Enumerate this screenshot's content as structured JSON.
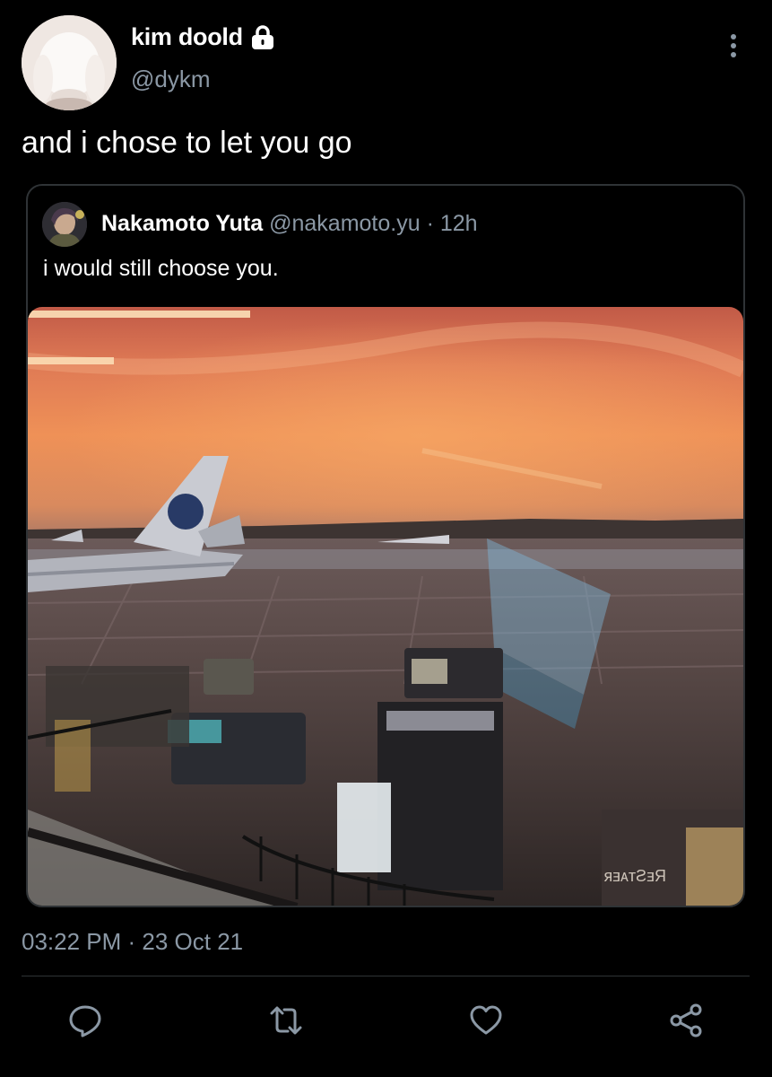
{
  "author": {
    "name": "kim doold",
    "handle": "@dykm",
    "protected_icon": "lock-icon"
  },
  "tweet": {
    "text": "and i chose to let you go",
    "timestamp": "03:22 PM · 23 Oct 21"
  },
  "quoted": {
    "name": "Nakamoto Yuta",
    "handle": "@nakamoto.yu",
    "separator": "·",
    "time": "12h",
    "text": "i would still choose you.",
    "image_text": "RᴇSᴛᴀᴇʀ"
  },
  "actions": {
    "icons": [
      "reply-icon",
      "retweet-icon",
      "like-icon",
      "share-icon"
    ]
  },
  "colors": {
    "background": "#000000",
    "primary_text": "#ffffff",
    "secondary_text": "#8b98a5",
    "border": "#2f3336"
  }
}
